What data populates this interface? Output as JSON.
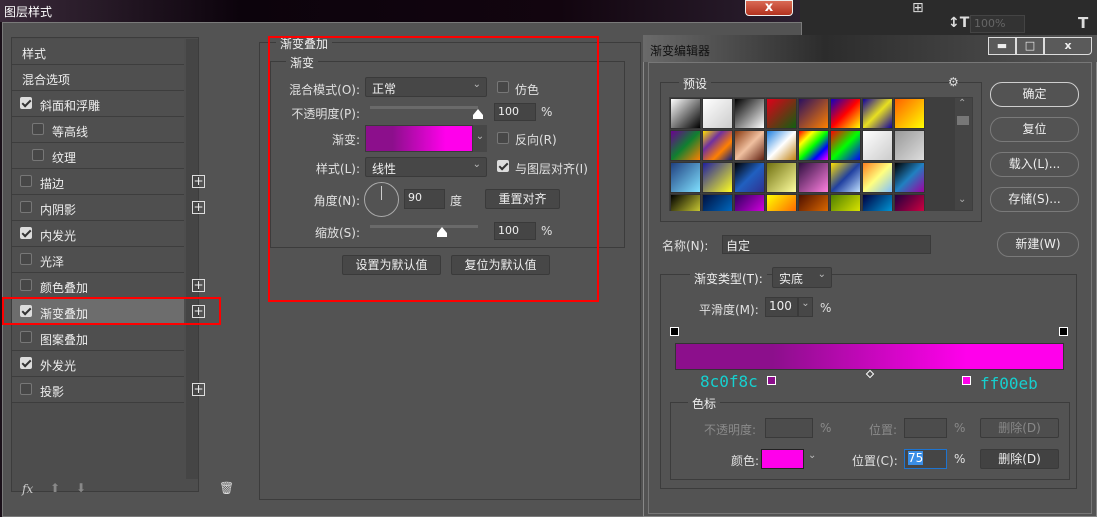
{
  "layer_style": {
    "title": "图层样式",
    "close": "x",
    "list": [
      {
        "label": "样式",
        "check": null,
        "plus": false,
        "indent": 0
      },
      {
        "label": "混合选项",
        "check": null,
        "plus": false,
        "indent": 0
      },
      {
        "label": "斜面和浮雕",
        "check": true,
        "plus": false,
        "indent": 0
      },
      {
        "label": "等高线",
        "check": false,
        "plus": false,
        "indent": 1
      },
      {
        "label": "纹理",
        "check": false,
        "plus": false,
        "indent": 1
      },
      {
        "label": "描边",
        "check": false,
        "plus": true,
        "indent": 0
      },
      {
        "label": "内阴影",
        "check": false,
        "plus": true,
        "indent": 0
      },
      {
        "label": "内发光",
        "check": true,
        "plus": false,
        "indent": 0
      },
      {
        "label": "光泽",
        "check": false,
        "plus": false,
        "indent": 0
      },
      {
        "label": "颜色叠加",
        "check": false,
        "plus": true,
        "indent": 0
      },
      {
        "label": "渐变叠加",
        "check": true,
        "plus": true,
        "indent": 0,
        "selected": true
      },
      {
        "label": "图案叠加",
        "check": false,
        "plus": false,
        "indent": 0
      },
      {
        "label": "外发光",
        "check": true,
        "plus": false,
        "indent": 0
      },
      {
        "label": "投影",
        "check": false,
        "plus": true,
        "indent": 0
      }
    ],
    "footer": {
      "fx": "fx"
    },
    "panel": {
      "group_title": "渐变叠加",
      "sub_title": "渐变",
      "blend_mode_label": "混合模式(O):",
      "blend_mode": "正常",
      "dither_label": "仿色",
      "opacity_label": "不透明度(P):",
      "opacity": "100",
      "opacity_value": 100,
      "pct": "%",
      "gradient_label": "渐变:",
      "reverse_label": "反向(R)",
      "style_label": "样式(L):",
      "style": "线性",
      "align_label": "与图层对齐(I)",
      "angle_label": "角度(N):",
      "angle": "90",
      "angle_unit": "度",
      "reset_align": "重置对齐",
      "scale_label": "缩放(S):",
      "scale": "100",
      "scale_value": 100,
      "set_default": "设置为默认值",
      "reset_default": "复位为默认值"
    }
  },
  "toolbar_bg": {
    "leading": "100%"
  },
  "gradient_editor": {
    "title": "渐变编辑器",
    "presets_label": "预设",
    "presets": [
      [
        "#ffffff",
        "#000000"
      ],
      [
        "#ffffff",
        "#cccccc"
      ],
      [
        "#000000",
        "#ffffff"
      ],
      [
        "#e0001a",
        "#106010"
      ],
      [
        "#2a1060",
        "#ff8000"
      ],
      [
        "#1000c0",
        "#ff0000",
        "#ffff00"
      ],
      [
        "#1000a0",
        "#e8e020",
        "#1000a0"
      ],
      [
        "#ff6000",
        "#ffff00"
      ],
      [
        "#6a0090",
        "#108030",
        "#ff8000"
      ],
      [
        "#ffe000",
        "#7030a0",
        "#ff8000",
        "#102080"
      ],
      [
        "#8a3a10",
        "#f0c0a0",
        "#602010"
      ],
      [
        "#2080e0",
        "#ffffff",
        "#c08010"
      ],
      [
        "#ff0000",
        "#ffff00",
        "#00ff00",
        "#0000ff",
        "#ff00ff"
      ],
      [
        "#ff0000",
        "#00ff00",
        "#0000ff"
      ],
      [
        "#ffffff",
        "#cccccc"
      ],
      [
        "#999999",
        "#dddddd"
      ],
      [
        "#204080",
        "#80e0ff"
      ],
      [
        "#2020a0",
        "#ffff20"
      ],
      [
        "#000000",
        "#2060c0",
        "#303090"
      ],
      [
        "#707010",
        "#ffffa0"
      ],
      [
        "#301040",
        "#ff80e0"
      ],
      [
        "#ffe000",
        "#2040a0",
        "#c0e0ff"
      ],
      [
        "#ff8020",
        "#ffff80",
        "#80c0ff"
      ],
      [
        "#000000",
        "#2080c0",
        "#a000a0"
      ],
      [
        "#000000",
        "#ffff40"
      ],
      [
        "#001040",
        "#0080e0"
      ],
      [
        "#300060",
        "#ff00ff"
      ],
      [
        "#ffff00",
        "#ff4000"
      ],
      [
        "#501000",
        "#ff8000"
      ],
      [
        "#508000",
        "#ffff00"
      ],
      [
        "#000040",
        "#00c0ff"
      ],
      [
        "#200040",
        "#ff0040"
      ]
    ],
    "ok": "确定",
    "reset": "复位",
    "load": "载入(L)...",
    "save": "存储(S)...",
    "name_label": "名称(N):",
    "name_value": "自定",
    "new": "新建(W)",
    "type_label": "渐变类型(T):",
    "type_value": "实底",
    "smooth_label": "平滑度(M):",
    "smooth_value": "100",
    "pct": "%",
    "gradient": {
      "stops": [
        {
          "color": "#8c0f8c",
          "position": 25
        },
        {
          "color": "#ff00eb",
          "position": 75
        }
      ],
      "midpoint": 50,
      "opacity_stops": [
        0,
        100
      ]
    },
    "annot_left": "8c0f8c",
    "annot_right": "ff00eb",
    "stops_group": "色标",
    "opacity_label": "不透明度:",
    "position_label": "位置:",
    "delete": "删除(D)",
    "color_label": "颜色:",
    "color": "#ff00eb",
    "position_c_label": "位置(C):",
    "position_value": "75"
  },
  "colors": {
    "highlight": "#ff0000"
  }
}
